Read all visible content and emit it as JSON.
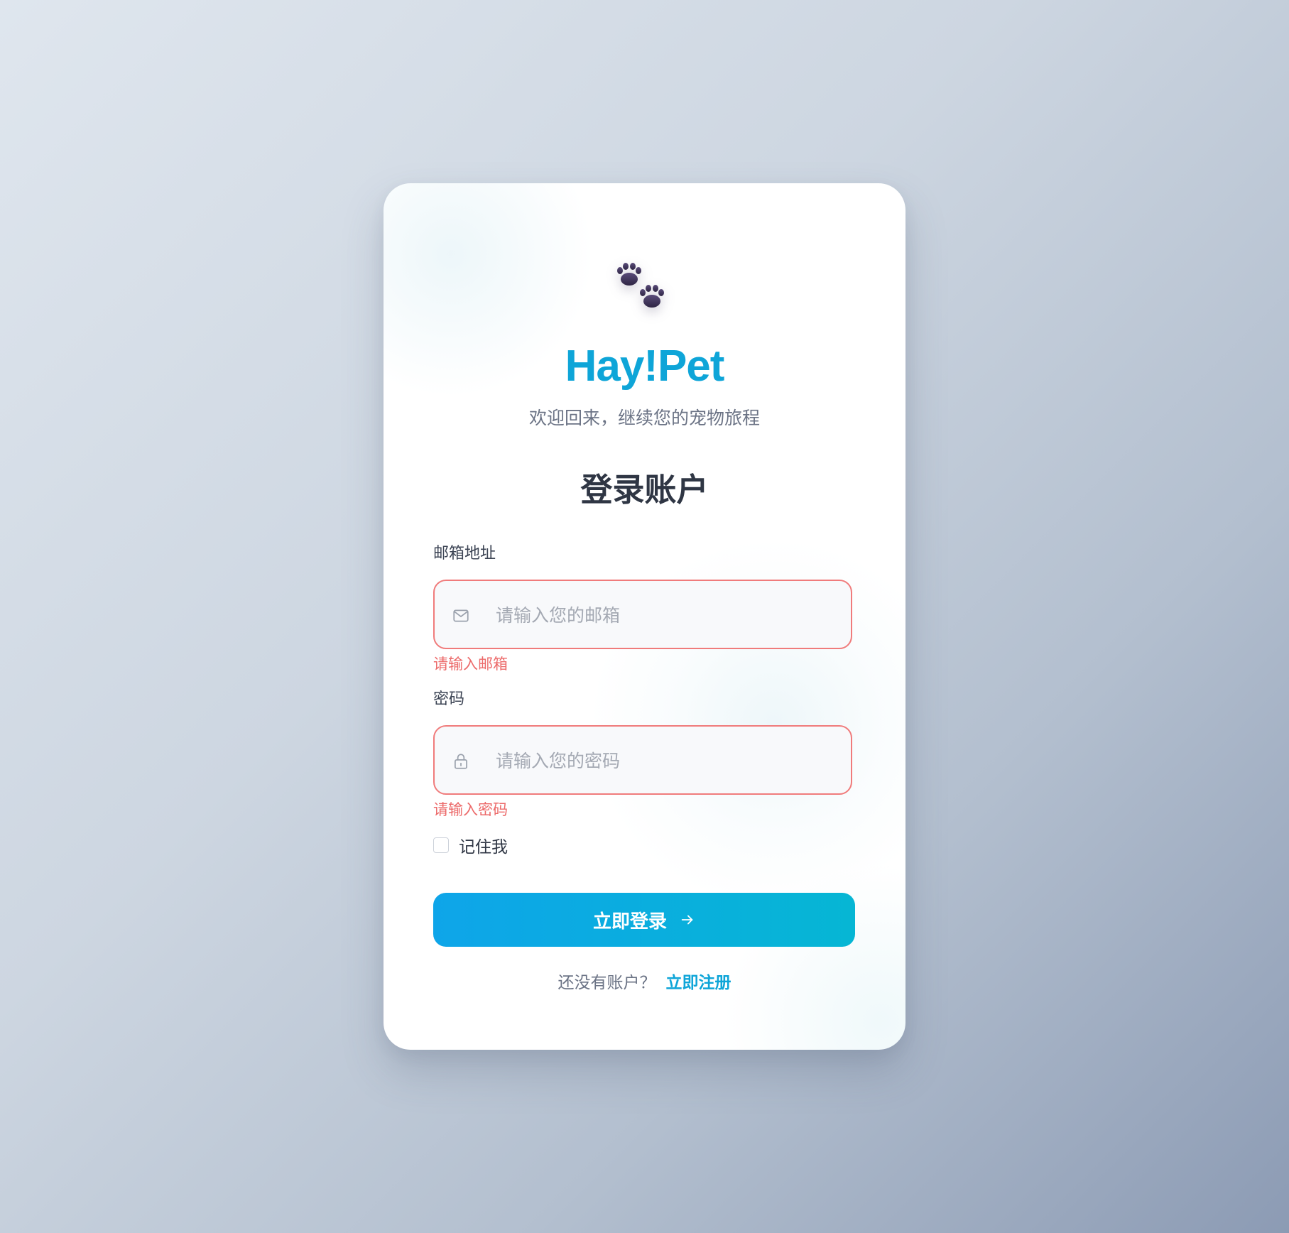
{
  "brand": {
    "name": "Hay!Pet",
    "tagline": "欢迎回来，继续您的宠物旅程",
    "logo_icon": "paw-prints-icon"
  },
  "form": {
    "title": "登录账户",
    "email": {
      "label": "邮箱地址",
      "placeholder": "请输入您的邮箱",
      "value": "",
      "icon": "mail-icon",
      "error": "请输入邮箱"
    },
    "password": {
      "label": "密码",
      "placeholder": "请输入您的密码",
      "value": "",
      "icon": "lock-icon",
      "error": "请输入密码"
    },
    "remember_me": {
      "label": "记住我",
      "checked": false
    },
    "submit_label": "立即登录",
    "submit_icon": "arrow-right-icon"
  },
  "footer": {
    "prompt": "还没有账户？",
    "signup_link": "立即注册"
  },
  "colors": {
    "brand": "#0ea5d8",
    "button_gradient_start": "#0ea5e9",
    "button_gradient_end": "#06b6d4",
    "error": "#ec6a6a",
    "input_error_border": "#f07b7b"
  }
}
